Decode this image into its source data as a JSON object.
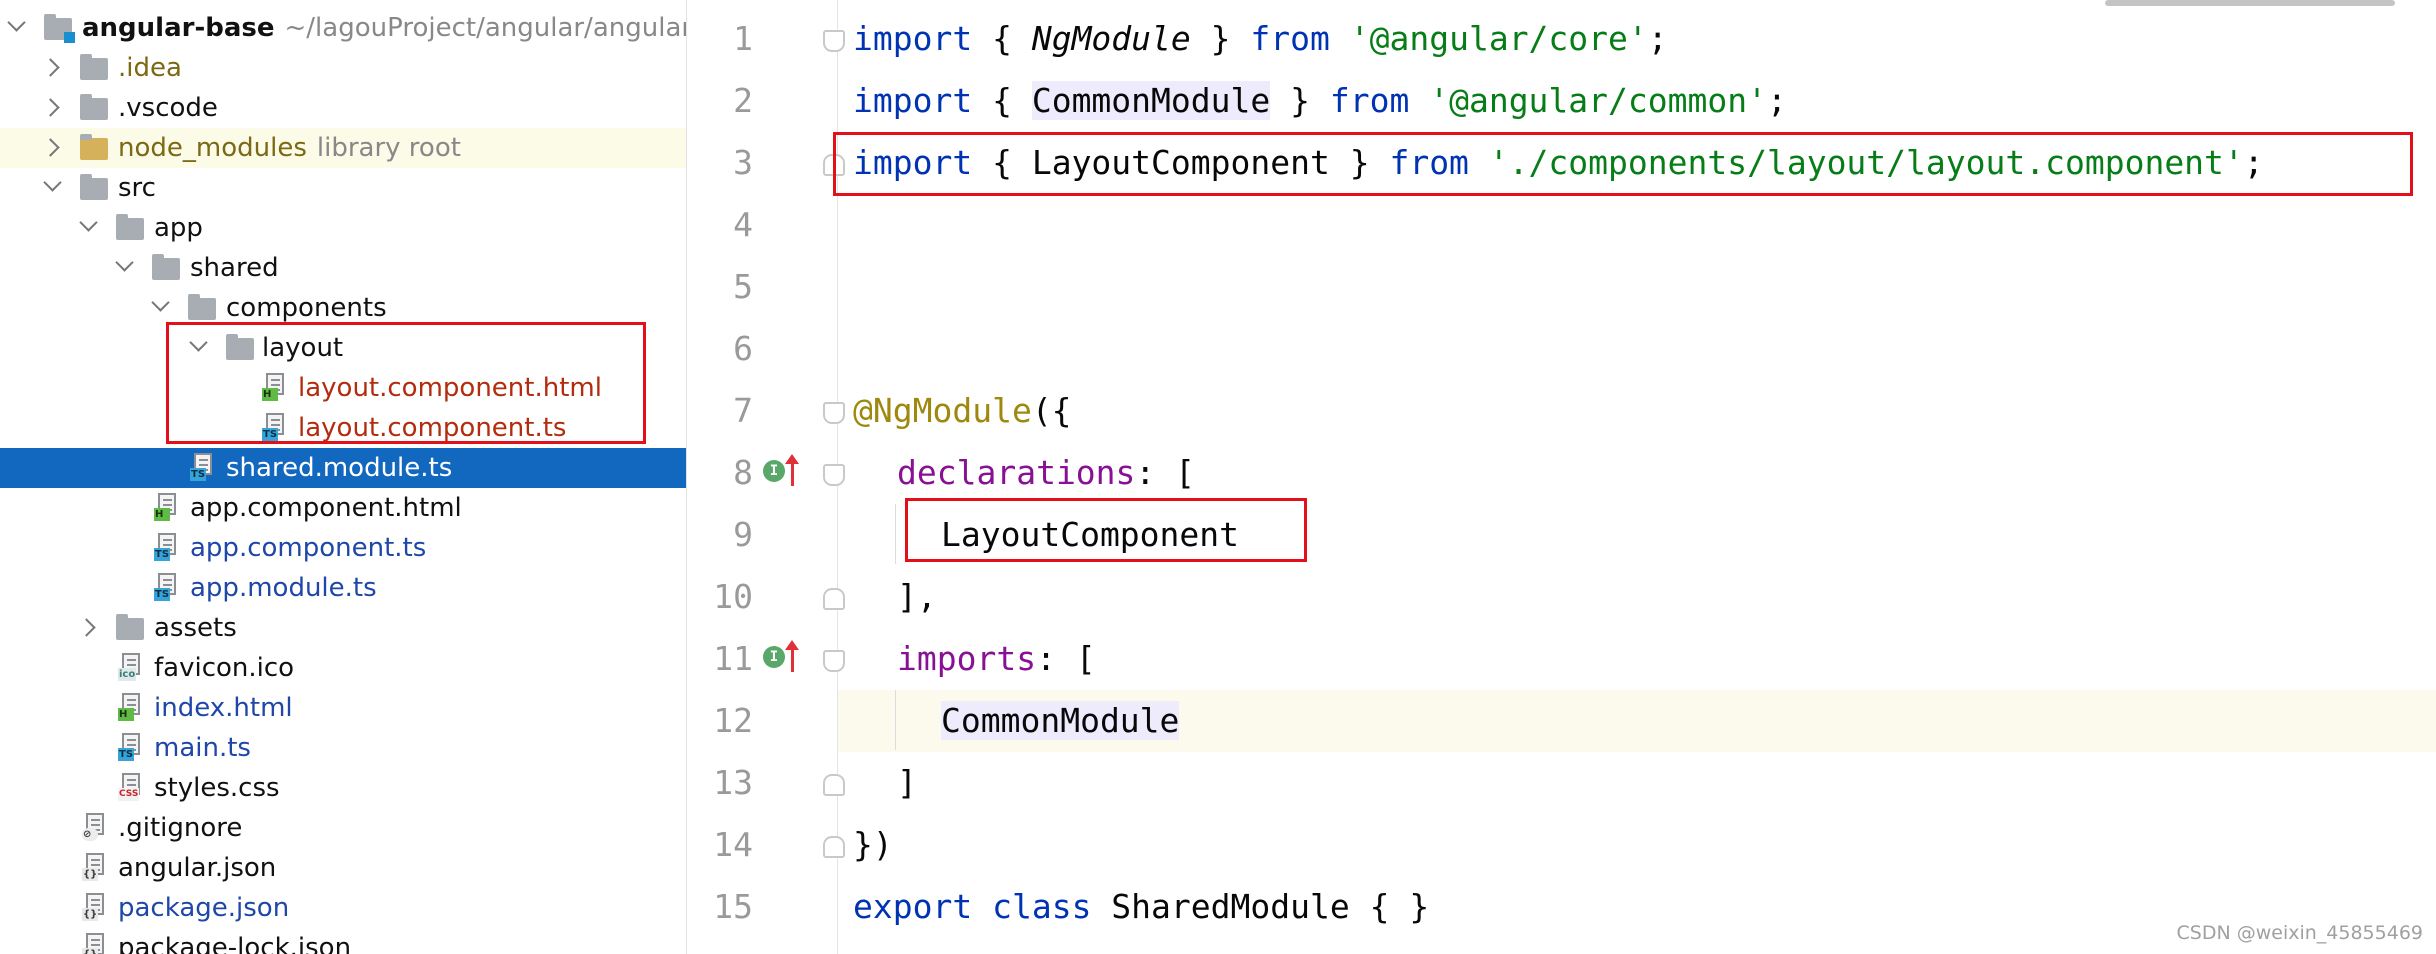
{
  "project_tree": {
    "root": {
      "name": "angular-base",
      "path_hint": "~/lagouProject/angular/angular-"
    },
    "items": [
      {
        "label": ".idea",
        "hint": ""
      },
      {
        "label": ".vscode",
        "hint": ""
      },
      {
        "label": "node_modules",
        "hint": "library root"
      },
      {
        "label": "src",
        "hint": ""
      },
      {
        "label": "app",
        "hint": ""
      },
      {
        "label": "shared",
        "hint": ""
      },
      {
        "label": "components",
        "hint": ""
      },
      {
        "label": "layout",
        "hint": ""
      },
      {
        "label": "layout.component.html",
        "hint": ""
      },
      {
        "label": "layout.component.ts",
        "hint": ""
      },
      {
        "label": "shared.module.ts",
        "hint": ""
      },
      {
        "label": "app.component.html",
        "hint": ""
      },
      {
        "label": "app.component.ts",
        "hint": ""
      },
      {
        "label": "app.module.ts",
        "hint": ""
      },
      {
        "label": "assets",
        "hint": ""
      },
      {
        "label": "favicon.ico",
        "hint": ""
      },
      {
        "label": "index.html",
        "hint": ""
      },
      {
        "label": "main.ts",
        "hint": ""
      },
      {
        "label": "styles.css",
        "hint": ""
      },
      {
        "label": ".gitignore",
        "hint": ""
      },
      {
        "label": "angular.json",
        "hint": ""
      },
      {
        "label": "package.json",
        "hint": ""
      },
      {
        "label": "package-lock.json",
        "hint": ""
      }
    ],
    "selected": "shared.module.ts"
  },
  "file_badges": {
    "html": "H",
    "ts": "TS",
    "css": "CSS",
    "json": "{}",
    "ico": "ico",
    "git": "⊘"
  },
  "editor": {
    "line_numbers": [
      "1",
      "2",
      "3",
      "4",
      "5",
      "6",
      "7",
      "8",
      "9",
      "10",
      "11",
      "12",
      "13",
      "14",
      "15"
    ],
    "current_line": "12",
    "gutter_marker": "I",
    "tokens": {
      "l1": [
        "import",
        " { ",
        "NgModule",
        " } ",
        "from",
        " ",
        "'@angular/core'",
        ";"
      ],
      "l2": [
        "import",
        " { ",
        "CommonModule",
        " } ",
        "from",
        " ",
        "'@angular/common'",
        ";"
      ],
      "l3": [
        "import",
        " { ",
        "LayoutComponent",
        " } ",
        "from",
        " ",
        "'./components/layout/layout.component'",
        ";"
      ],
      "l7": [
        "@NgModule",
        "({"
      ],
      "l8": [
        "declarations",
        ": ["
      ],
      "l9": [
        "LayoutComponent"
      ],
      "l10": [
        "],"
      ],
      "l11": [
        "imports",
        ": ["
      ],
      "l12": [
        "CommonModule"
      ],
      "l13": [
        "]"
      ],
      "l14": [
        "})"
      ],
      "l15": [
        "export",
        " ",
        "class",
        " SharedModule { }"
      ]
    }
  },
  "colors": {
    "keyword": "#0033b3",
    "string": "#067d17",
    "annotation": "#9e880d",
    "property": "#871094",
    "selection": "#1268bf",
    "highlight_box": "#e3101a"
  },
  "watermark": "CSDN @weixin_45855469"
}
